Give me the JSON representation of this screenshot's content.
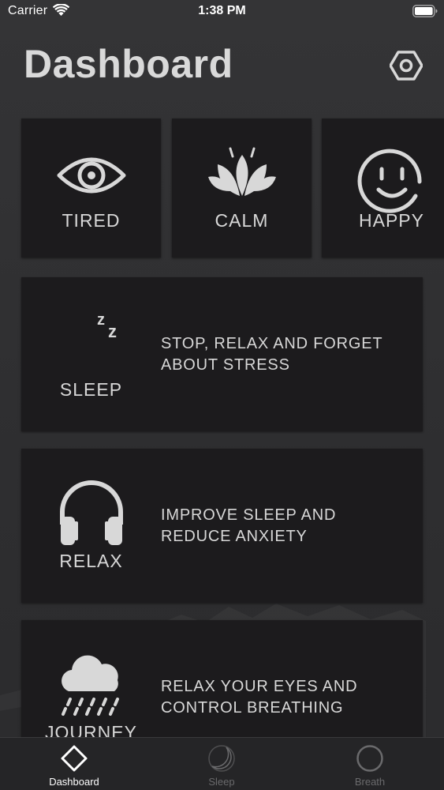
{
  "status_bar": {
    "carrier": "Carrier",
    "time": "1:38 PM",
    "icons": [
      "wifi-icon",
      "battery-icon"
    ]
  },
  "header": {
    "title": "Dashboard",
    "settings_icon": "gear-hexagon-icon"
  },
  "moods": [
    {
      "label": "TIRED",
      "icon": "eye-icon"
    },
    {
      "label": "CALM",
      "icon": "lotus-icon"
    },
    {
      "label": "HAPPY",
      "icon": "smiley-icon"
    }
  ],
  "activities": [
    {
      "label": "SLEEP",
      "description": "STOP, RELAX AND FORGET ABOUT STRESS",
      "icon": "moon-zzz-icon"
    },
    {
      "label": "RELAX",
      "description": "IMPROVE SLEEP AND REDUCE ANXIETY",
      "icon": "headphones-icon"
    },
    {
      "label": "JOURNEY",
      "description": "RELAX YOUR EYES AND CONTROL BREATHING",
      "icon": "rain-cloud-icon"
    }
  ],
  "tabs": [
    {
      "label": "Dashboard",
      "icon": "diamond-icon",
      "active": true
    },
    {
      "label": "Sleep",
      "icon": "moon-icon",
      "active": false
    },
    {
      "label": "Breath",
      "icon": "circle-icon",
      "active": false
    }
  ],
  "colors": {
    "background": "#2d2d2f",
    "tile": "#1c1b1d",
    "text": "#d8d8d8",
    "tab_active": "#ffffff",
    "tab_inactive": "#6a6a6c"
  }
}
